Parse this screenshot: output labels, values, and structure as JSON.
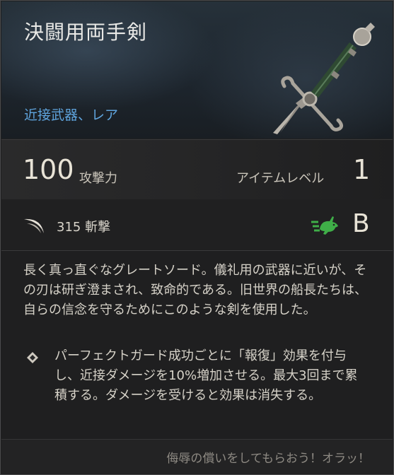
{
  "item": {
    "name": "決闘用両手剣",
    "type": "近接武器、レア",
    "icon": "longsword-icon"
  },
  "stats": {
    "attack_value": "100",
    "attack_label": "攻撃力",
    "level_label": "アイテムレベル",
    "level_value": "1"
  },
  "damage": {
    "icon": "slash-icon",
    "text": "315 斬撃",
    "agility_icon": "rabbit-icon",
    "agility_color": "#3fae48",
    "grade": "B"
  },
  "description": "長く真っ直ぐなグレートソード。儀礼用の武器に近いが、その刃は研ぎ澄まされ、致命的である。旧世界の船長たちは、自らの信念を守るためにこのような剣を使用した。",
  "perk": {
    "icon": "diamond-bullet-icon",
    "text": "パーフェクトガード成功ごとに「報復」効果を付与し、近接ダメージを10%増加させる。最大3回まで累積する。ダメージを受けると効果は消失する。"
  },
  "flavor": "侮辱の償いをしてもらおう！オラッ！",
  "colors": {
    "accent_blue": "#5fa4dd",
    "text_light": "#e8e3d6",
    "background": "#1f1f20"
  }
}
